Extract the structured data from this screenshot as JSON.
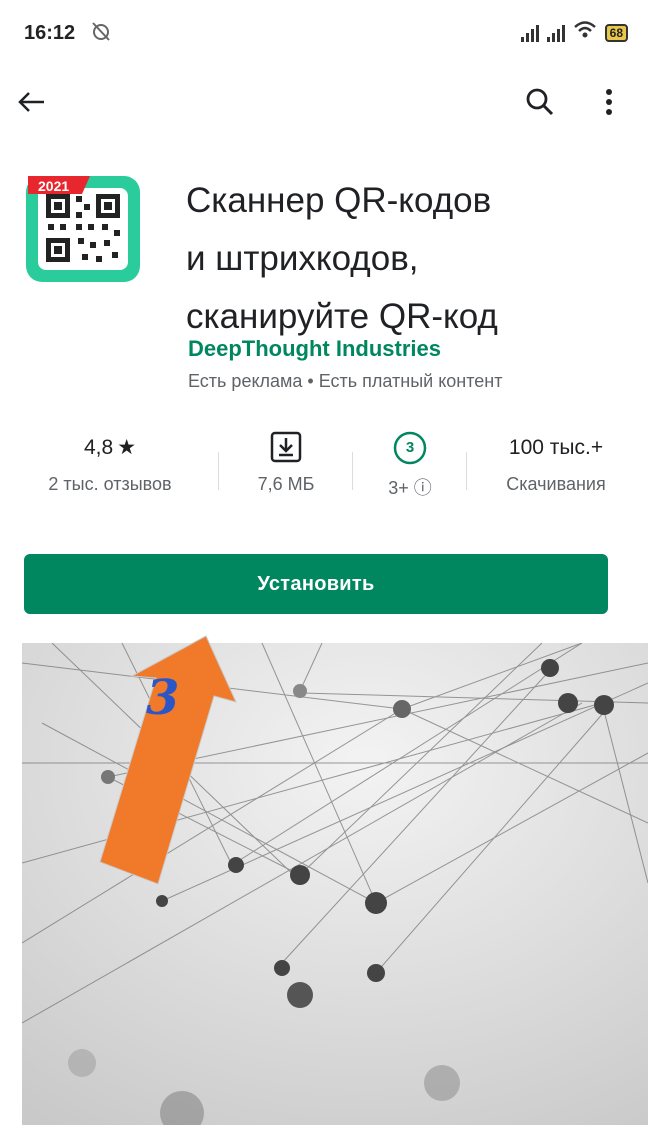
{
  "status": {
    "time": "16:12",
    "battery": "68",
    "icons": [
      "no-alarm-icon",
      "signal-icon",
      "signal-icon",
      "wifi-icon",
      "battery-icon"
    ]
  },
  "topbar": {
    "icons": [
      "back-arrow-icon",
      "search-icon",
      "more-vert-icon"
    ]
  },
  "app": {
    "icon_badge": "2021",
    "title_lines": [
      "Сканнер QR-кодов",
      "и штрихкодов,",
      "сканируйте QR-код"
    ],
    "developer": "DeepThought Industries",
    "meta": "Есть реклама  •  Есть платный контент"
  },
  "stats": [
    {
      "value": "4,8",
      "star": "★",
      "label": "2 тыс. отзывов"
    },
    {
      "icon": "download-icon",
      "label": "7,6 МБ"
    },
    {
      "icon": "age-rating-icon",
      "badge": "3",
      "label": "3+ ⓘ"
    },
    {
      "value": "100 тыс.+",
      "label": "Скачивания"
    }
  ],
  "install_label": "Установить",
  "annotation": {
    "number": "3",
    "color": "#f07a2a"
  },
  "colors": {
    "accent": "#01875f",
    "text": "#202124",
    "muted": "#5f6368"
  }
}
